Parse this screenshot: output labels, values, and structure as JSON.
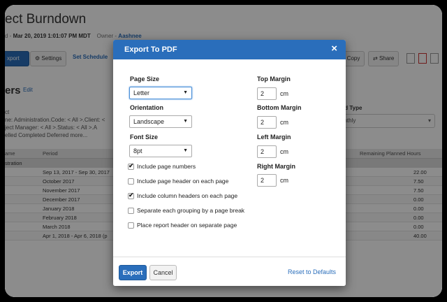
{
  "background": {
    "title": "ect Burndown",
    "meta_prefix": "d - ",
    "meta_date": "Mar 20, 2019 1:01:07 PM MDT",
    "meta_owner_label": "Owner - ",
    "meta_owner": "Aashnee",
    "toolbar": {
      "export_label": "xport",
      "settings_label": "Settings",
      "schedule_label": "Set Schedule",
      "copy_label": "a Copy",
      "share_label": "Share"
    },
    "section_title": "ers",
    "edit_label": "Edit",
    "filters": {
      "line1": "ct",
      "line2": "ne: Administration.Code: < All >.Client: <",
      "line3": "ject Manager: < All >.Status: < All >.A",
      "line4": "elled Completed Deferred more..."
    },
    "period_type_label": "riod Type",
    "period_type_value": "onthly",
    "table": {
      "headers": [
        "ame",
        "Period",
        "Remaining Planned Hours"
      ],
      "group": "stration",
      "rows": [
        {
          "period": "Sep 13, 2017 - Sep 30, 2017",
          "hours": "22.00"
        },
        {
          "period": "October 2017",
          "hours": "7.50"
        },
        {
          "period": "November 2017",
          "hours": "7.50"
        },
        {
          "period": "December 2017",
          "hours": "0.00"
        },
        {
          "period": "January 2018",
          "hours": "0.00"
        },
        {
          "period": "February 2018",
          "hours": "0.00"
        },
        {
          "period": "March 2018",
          "hours": "0.00"
        },
        {
          "period": "Apr 1, 2018 - Apr 6, 2018 (p",
          "hours": "40.00"
        }
      ]
    }
  },
  "dialog": {
    "title": "Export To PDF",
    "close_glyph": "×",
    "page_size": {
      "label": "Page Size",
      "value": "Letter"
    },
    "orientation": {
      "label": "Orientation",
      "value": "Landscape"
    },
    "font_size": {
      "label": "Font Size",
      "value": "8pt"
    },
    "checkboxes": [
      {
        "label": "Include page numbers",
        "checked": true
      },
      {
        "label": "Include page header on each page",
        "checked": false
      },
      {
        "label": "Include column headers on each page",
        "checked": true
      },
      {
        "label": "Separate each grouping by a page break",
        "checked": false
      },
      {
        "label": "Place report header on separate page",
        "checked": false
      }
    ],
    "margins": {
      "top": {
        "label": "Top Margin",
        "value": "2",
        "unit": "cm"
      },
      "bottom": {
        "label": "Bottom Margin",
        "value": "2",
        "unit": "cm"
      },
      "left": {
        "label": "Left Margin",
        "value": "2",
        "unit": "cm"
      },
      "right": {
        "label": "Right Margin",
        "value": "2",
        "unit": "cm"
      }
    },
    "buttons": {
      "export": "Export",
      "cancel": "Cancel",
      "reset": "Reset to Defaults"
    }
  },
  "colors": {
    "accent": "#2a6ebb",
    "overlay": "rgba(0,0,0,0.45)"
  }
}
